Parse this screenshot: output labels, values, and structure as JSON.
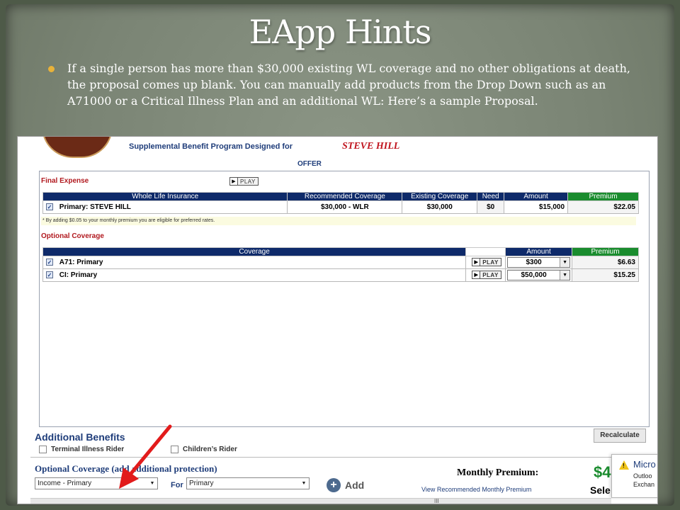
{
  "slide": {
    "title": "EApp Hints",
    "bullet": "If a single person has more than $30,000 existing WL coverage and no other obligations at death, the proposal comes up blank. You can manually add products from the Drop Down such as an A71000 or a Critical Illness Plan and an additional WL: Here’s a sample Proposal."
  },
  "screenshot": {
    "banner_title": "Supplemental Benefit Program Designed for",
    "client_name": "STEVE HILL",
    "offer_label": "OFFER",
    "play_label": "PLAY",
    "final_expense": {
      "title": "Final Expense",
      "headers": [
        "Whole Life Insurance",
        "Recommended Coverage",
        "Existing Coverage",
        "Need",
        "Amount",
        "Premium"
      ],
      "rows": [
        {
          "name": "Primary: STEVE HILL",
          "recommended": "$30,000 - WLR",
          "existing": "$30,000",
          "need": "$0",
          "amount": "$15,000",
          "premium": "$22.05"
        }
      ],
      "note": "* By adding $0.05 to your monthly premium you are eligible for preferred rates."
    },
    "optional_coverage": {
      "title": "Optional Coverage",
      "headers": [
        "Coverage",
        "Amount",
        "Premium"
      ],
      "rows": [
        {
          "name": "A71: Primary",
          "amount": "$300",
          "premium": "$6.63"
        },
        {
          "name": "CI: Primary",
          "amount": "$50,000",
          "premium": "$15.25"
        }
      ]
    },
    "additional_benefits": {
      "title": "Additional Benefits",
      "terminal_illness": "Terminal Illness Rider",
      "childrens": "Children’s Rider",
      "recalculate": "Recalculate"
    },
    "bottom": {
      "optional_title": "Optional Coverage (add additional protection)",
      "product_value": "Income - Primary",
      "for_label": "For",
      "for_value": "Primary",
      "add_label": "Add",
      "monthly_premium": "Monthly Premium:",
      "view_recommended": "View Recommended Monthly Premium",
      "price_partial": "$4",
      "select_partial": "Sele"
    },
    "toast": {
      "title": "Micro",
      "line1": "Outloo",
      "line2": "Exchan"
    },
    "scroll_marker": "III"
  },
  "colors": {
    "header_blue": "#0e2a6a",
    "premium_green": "#1a8c2e",
    "accent_red": "#b1191f",
    "arrow_red": "#e21b1b",
    "bullet_gold": "#e8b23a"
  }
}
